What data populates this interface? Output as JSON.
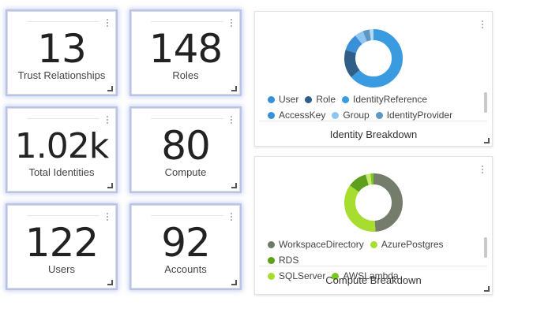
{
  "stats": [
    {
      "value": "13",
      "label": "Trust Relationships"
    },
    {
      "value": "148",
      "label": "Roles"
    },
    {
      "value": "1.02k",
      "label": "Total Identities"
    },
    {
      "value": "80",
      "label": "Compute"
    },
    {
      "value": "122",
      "label": "Users"
    },
    {
      "value": "92",
      "label": "Accounts"
    }
  ],
  "identity": {
    "title": "Identity Breakdown",
    "legend": [
      {
        "label": "User",
        "color": "#3a8fd9"
      },
      {
        "label": "Role",
        "color": "#2f5f86"
      },
      {
        "label": "IdentityReference",
        "color": "#3a9be0"
      },
      {
        "label": "AccessKey",
        "color": "#3a8fd9"
      },
      {
        "label": "Group",
        "color": "#8ec6f2"
      },
      {
        "label": "IdentityProvider",
        "color": "#5e97c2"
      }
    ]
  },
  "compute": {
    "title": "Compute Breakdown",
    "legend": [
      {
        "label": "WorkspaceDirectory",
        "color": "#6f7a66"
      },
      {
        "label": "AzurePostgres",
        "color": "#a6dd2e"
      },
      {
        "label": "RDS",
        "color": "#5e9f1e"
      },
      {
        "label": "SQLServer",
        "color": "#a6dd2e"
      },
      {
        "label": "AWSLambda",
        "color": "#79c81e"
      }
    ]
  }
}
